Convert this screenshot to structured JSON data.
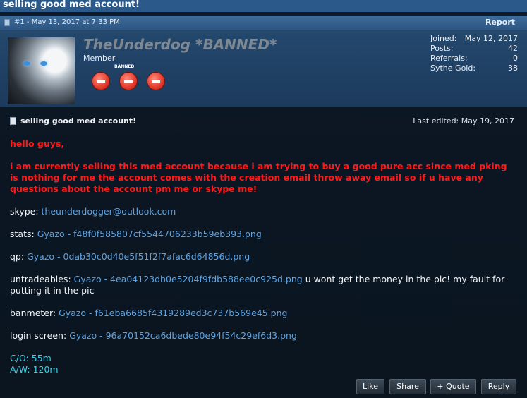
{
  "thread": {
    "title": "selling good med account!"
  },
  "post_header": {
    "meta": "#1 - May 13, 2017 at 7:33 PM",
    "report_label": "Report"
  },
  "user": {
    "name": "TheUnderdog *BANNED*",
    "title": "Member",
    "badge_label": "BANNED",
    "stats": [
      {
        "label": "Joined:",
        "value": "May 12, 2017"
      },
      {
        "label": "Posts:",
        "value": "42"
      },
      {
        "label": "Referrals:",
        "value": "0"
      },
      {
        "label": "Sythe Gold:",
        "value": "38"
      }
    ]
  },
  "post": {
    "title": "selling good med account!",
    "last_edited": "Last edited: May 19, 2017",
    "greeting": "hello guys,",
    "intro": "i am currently selling this med account because i am trying to buy a good pure acc since med pking is nothing for me the account comes with the creation email throw away email so if u have any questions about the account pm me or skype me!",
    "skype_label": "skype:",
    "skype_value": "theunderdogger@outlook.com",
    "stats_label": "stats:",
    "stats_link": "Gyazo - f48f0f585807cf5544706233b59eb393.png",
    "qp_label": "qp:",
    "qp_link": "Gyazo - 0dab30c0d40e5f51f2f7afac6d64856d.png",
    "untradeables_label": "untradeables:",
    "untradeables_link": "Gyazo - 4ea04123db0e5204f9fdb588ee0c925d.png",
    "untradeables_note": "u wont get the money in the pic! my fault for putting it in the pic",
    "banmeter_label": "banmeter:",
    "banmeter_link": "Gyazo - f61eba6685f4319289ed3c737b569e45.png",
    "login_label": "login screen:",
    "login_link": "Gyazo - 96a70152ca6dbede80e94f54c29ef6d3.png",
    "co": "C/O: 55m",
    "aw": "A/W: 120m"
  },
  "actions": {
    "like": "Like",
    "share": "Share",
    "quote": "+ Quote",
    "reply": "Reply"
  },
  "colors": {
    "header_blue": "#2b5a8a",
    "text_red": "#ff1a1a",
    "link_blue": "#5ba4e6",
    "cyan": "#3fd3e8"
  }
}
